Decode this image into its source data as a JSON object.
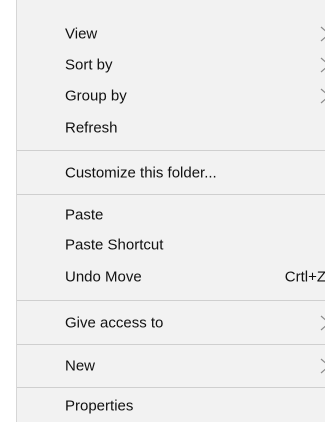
{
  "context_menu": {
    "items": [
      {
        "label": "View",
        "has_submenu": true
      },
      {
        "label": "Sort by",
        "has_submenu": true
      },
      {
        "label": "Group by",
        "has_submenu": true
      },
      {
        "label": "Refresh"
      },
      {
        "label": "Customize this folder..."
      },
      {
        "label": "Paste"
      },
      {
        "label": "Paste Shortcut"
      },
      {
        "label": "Undo Move",
        "shortcut": "Crtl+Z"
      },
      {
        "label": "Give access to",
        "has_submenu": true
      },
      {
        "label": "New",
        "has_submenu": true
      },
      {
        "label": "Properties"
      }
    ]
  },
  "colors": {
    "menu_background": "#f2f2f2",
    "separator": "#cfcfcf",
    "text": "#111111",
    "chevron": "#8a8a8a"
  }
}
